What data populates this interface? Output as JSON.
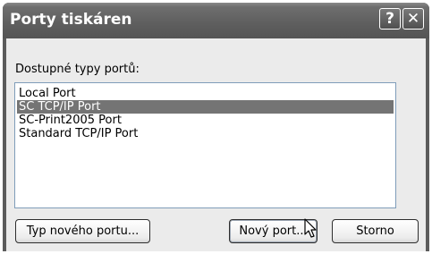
{
  "window": {
    "title": "Porty tiskáren"
  },
  "titlebar": {
    "help_glyph": "?",
    "close_glyph": "✕"
  },
  "dialog": {
    "list_label": "Dostupné typy portů:",
    "port_types": [
      "Local Port",
      "SC TCP/IP Port",
      "SC-Print2005 Port",
      "Standard TCP/IP Port"
    ],
    "selected_index": 1
  },
  "buttons": {
    "new_port_type": "Typ nového portu...",
    "new_port": "Nový port...",
    "cancel": "Storno"
  }
}
